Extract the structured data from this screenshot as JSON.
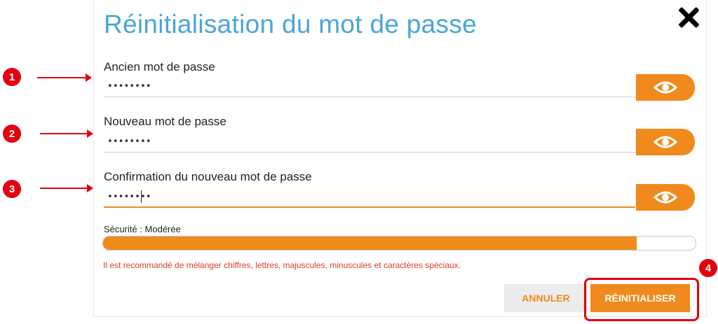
{
  "dialog": {
    "title": "Réinitialisation du mot de passe",
    "close_icon": "close-icon"
  },
  "fields": [
    {
      "label": "Ancien mot de passe",
      "value": "••••••••"
    },
    {
      "label": "Nouveau mot de passe",
      "value": "••••••••"
    },
    {
      "label": "Confirmation du nouveau mot de passe",
      "value": "••••••••"
    }
  ],
  "eye_icon": "eye-icon",
  "security": {
    "label": "Sécurité : Modérée",
    "strength_percent": 90
  },
  "hint": "Il est recommandé de mélanger chiffres, lettres, majuscules, minuscules et caractères spéciaux.",
  "buttons": {
    "cancel": "ANNULER",
    "reset": "RÉINITIALISER"
  },
  "annotations": [
    "1",
    "2",
    "3",
    "4"
  ],
  "colors": {
    "accent": "#f18a1c",
    "title": "#4aa6d6",
    "annotation": "#e3000f",
    "hint": "#e0392b"
  }
}
